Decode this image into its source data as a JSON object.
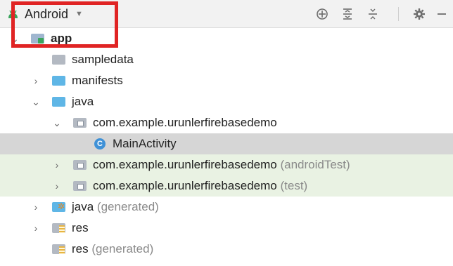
{
  "toolbar": {
    "view_selector": "Android",
    "tools": [
      "locate-icon",
      "expand-all-icon",
      "collapse-all-icon",
      "gear-icon",
      "hide-icon"
    ]
  },
  "colors": {
    "highlight_box": "#e02424",
    "selected_row": "#d6d6d6",
    "test_row": "#e9f2e3",
    "android_green": "#3ba55d"
  },
  "tree": {
    "rows": [
      {
        "name": "app",
        "suffix": "",
        "icon": "module-folder-icon",
        "expanded": true
      },
      {
        "name": "sampledata",
        "suffix": "",
        "icon": "folder-icon"
      },
      {
        "name": "manifests",
        "suffix": "",
        "icon": "source-folder-icon",
        "expanded": false
      },
      {
        "name": "java",
        "suffix": "",
        "icon": "source-folder-icon",
        "expanded": true
      },
      {
        "name": "com.example.urunlerfirebasedemo",
        "suffix": "",
        "icon": "package-icon",
        "expanded": true
      },
      {
        "name": "MainActivity",
        "suffix": "",
        "icon": "class-icon",
        "class_letter": "C",
        "selected": true
      },
      {
        "name": "com.example.urunlerfirebasedemo",
        "suffix": "(androidTest)",
        "icon": "package-icon",
        "expanded": false
      },
      {
        "name": "com.example.urunlerfirebasedemo",
        "suffix": "(test)",
        "icon": "package-icon",
        "expanded": false
      },
      {
        "name": "java",
        "suffix": "(generated)",
        "icon": "generated-folder-icon",
        "expanded": false
      },
      {
        "name": "res",
        "suffix": "",
        "icon": "res-folder-icon",
        "expanded": false
      },
      {
        "name": "res",
        "suffix": "(generated)",
        "icon": "res-folder-icon"
      }
    ]
  }
}
